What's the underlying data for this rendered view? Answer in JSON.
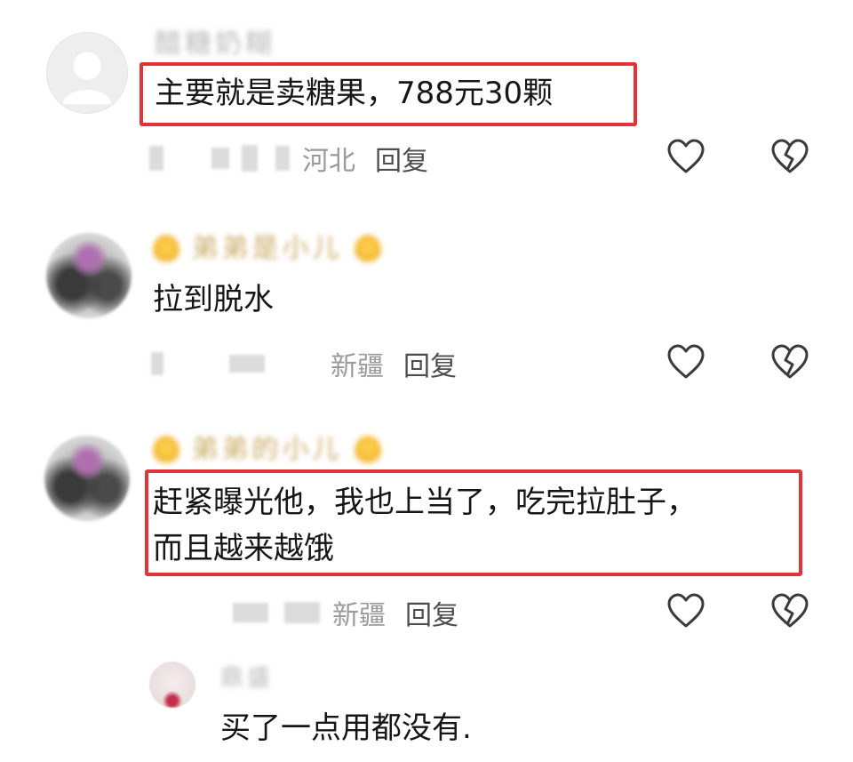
{
  "comments": [
    {
      "username": "醋糖奶糊",
      "text": "主要就是卖糖果，788元30颗",
      "location": "河北",
      "reply_label": "回复",
      "highlighted": true,
      "like_icon": "heart-outline-icon",
      "dislike_icon": "broken-heart-icon"
    },
    {
      "username": "弟弟是小儿",
      "text": "拉到脱水",
      "location": "新疆",
      "reply_label": "回复",
      "highlighted": false,
      "like_icon": "heart-outline-icon",
      "dislike_icon": "broken-heart-icon"
    },
    {
      "username": "弟弟的小儿",
      "text_line1": "赶紧曝光他，我也上当了，吃完拉肚子，",
      "text_line2": "而且越来越饿",
      "location": "新疆",
      "reply_label": "回复",
      "highlighted": true,
      "like_icon": "heart-outline-icon",
      "dislike_icon": "broken-heart-icon"
    },
    {
      "username": "鼎盛",
      "text": "买了一点用都没有."
    }
  ],
  "colors": {
    "highlight_border": "#e0333a",
    "location_text": "#9a9a9a",
    "reply_text": "#4d4d4d",
    "comment_text": "#161616"
  }
}
